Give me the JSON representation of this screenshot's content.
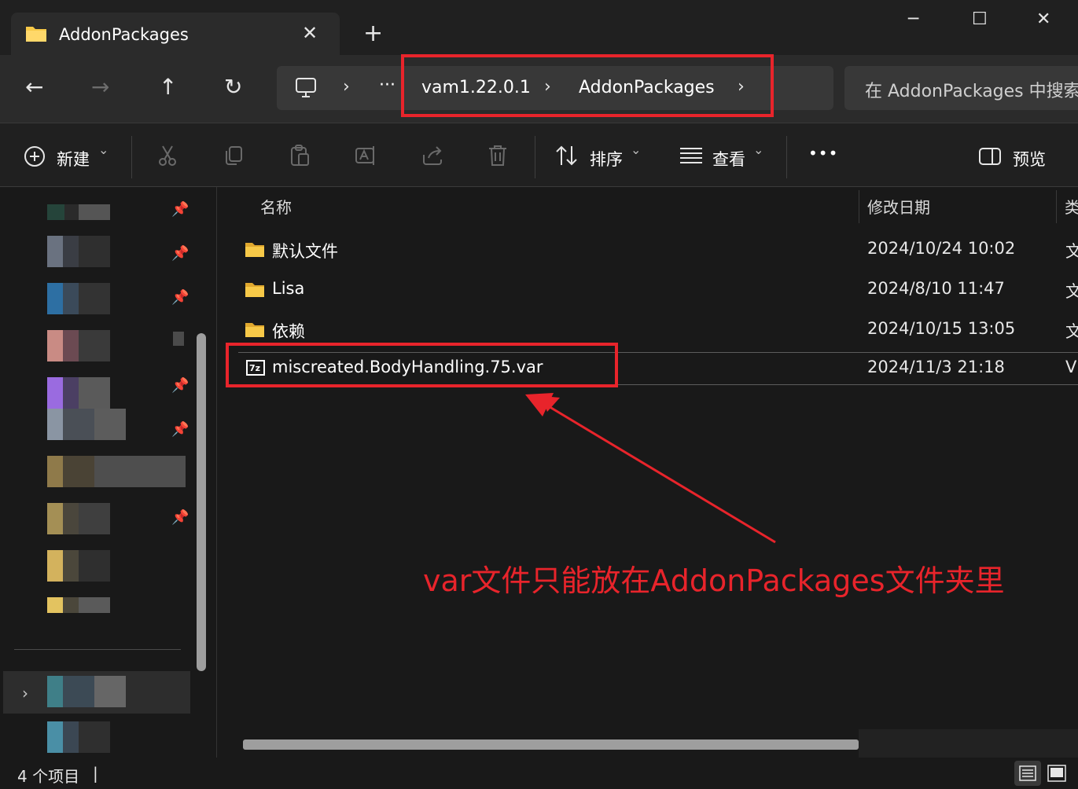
{
  "window": {
    "tab_title": "AddonPackages",
    "tab_close": "✕",
    "new_tab": "+",
    "minimize": "─",
    "maximize": "☐",
    "close": "✕"
  },
  "nav": {
    "back": "←",
    "forward": "→",
    "up": "↑",
    "refresh": "↻",
    "crumb_sep": "›",
    "overflow": "···",
    "breadcrumbs": [
      "vam1.22.0.1",
      "AddonPackages"
    ],
    "search_placeholder": "在 AddonPackages 中搜索"
  },
  "toolbar": {
    "new_label": "新建",
    "new_chevron": "⌄",
    "sort_label": "排序",
    "view_label": "查看",
    "more": "•••",
    "preview_label": "预览"
  },
  "columns": {
    "name": "名称",
    "date": "修改日期",
    "type": "类"
  },
  "files": [
    {
      "name": "默认文件",
      "date": "2024/10/24 10:02",
      "type": "文",
      "kind": "folder"
    },
    {
      "name": "Lisa",
      "date": "2024/8/10 11:47",
      "type": "文",
      "kind": "folder"
    },
    {
      "name": "依赖",
      "date": "2024/10/15 13:05",
      "type": "文",
      "kind": "folder"
    },
    {
      "name": "miscreated.BodyHandling.75.var",
      "date": "2024/11/3 21:18",
      "type": "V",
      "kind": "7z"
    }
  ],
  "annotation": "var文件只能放在AddonPackages文件夹里",
  "status": {
    "count": "4 个项目",
    "cursor": "|"
  },
  "colors": {
    "highlight": "#e8242b",
    "folder": "#f7c948",
    "background": "#191919"
  }
}
